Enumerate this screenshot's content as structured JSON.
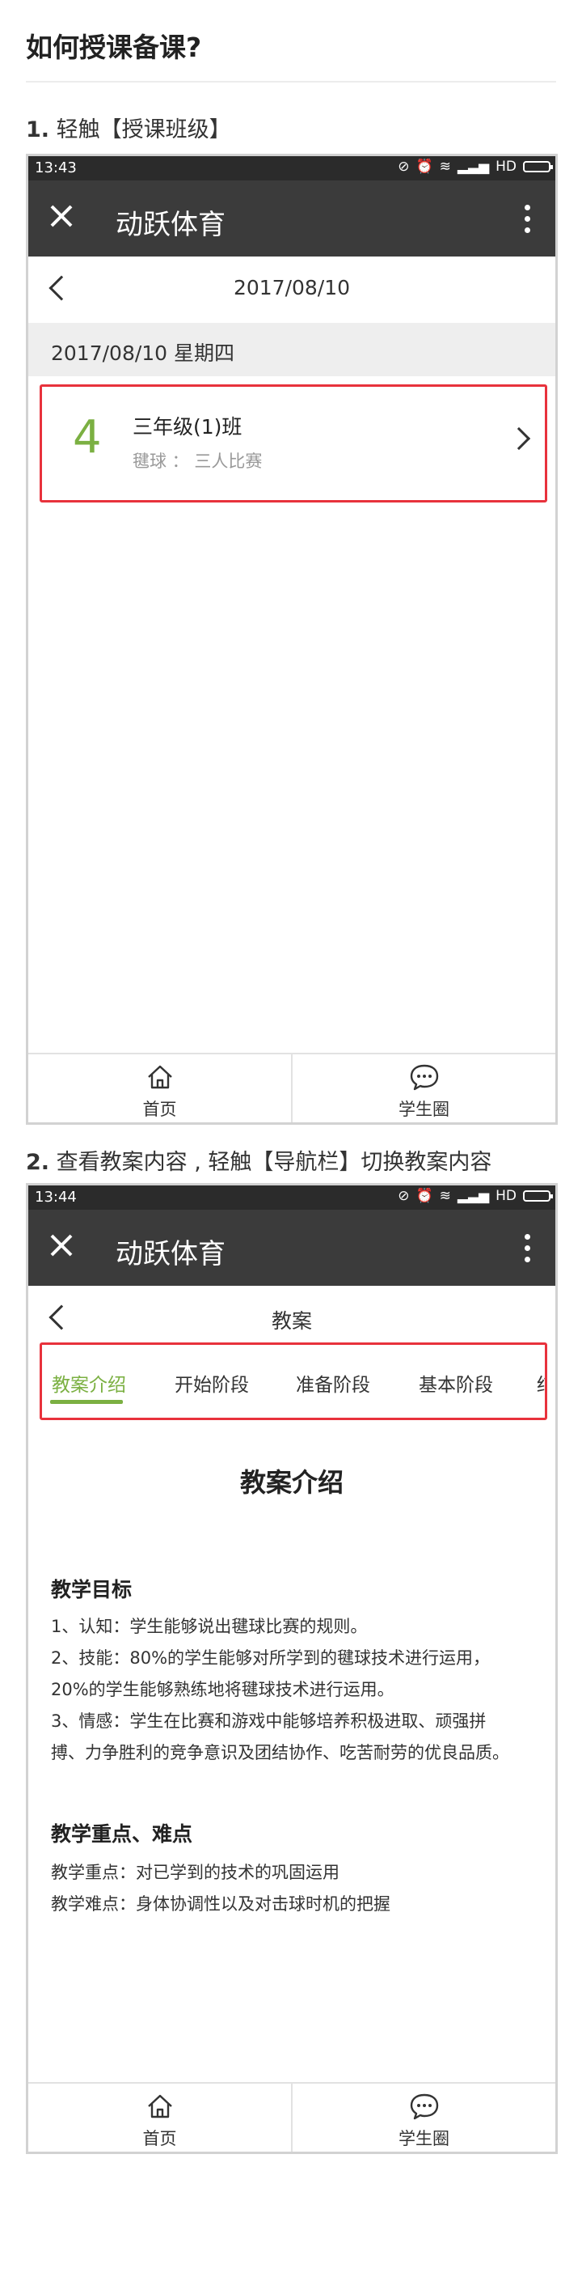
{
  "page": {
    "title": "如何授课备课?"
  },
  "step1": {
    "num": "1.",
    "text": "轻触【授课班级】",
    "status": {
      "time": "13:43",
      "network": "HD"
    },
    "appbar": {
      "title": "动跃体育"
    },
    "nav": {
      "title": "2017/08/10"
    },
    "date_header": "2017/08/10 星期四",
    "class_item": {
      "count": "4",
      "name": "三年级(1)班",
      "subtitle": "毽球 ： 三人比赛"
    },
    "tabbar": [
      {
        "label": "首页",
        "icon": "home-icon"
      },
      {
        "label": "学生圈",
        "icon": "chat-bubble-icon"
      }
    ]
  },
  "step2": {
    "num": "2.",
    "text": "查看教案内容 , 轻触【导航栏】切换教案内容",
    "status": {
      "time": "13:44",
      "network": "HD"
    },
    "appbar": {
      "title": "动跃体育"
    },
    "nav": {
      "title": "教案"
    },
    "tabs": [
      "教案介绍",
      "开始阶段",
      "准备阶段",
      "基本阶段",
      "结束"
    ],
    "active_tab": "教案介绍",
    "doc": {
      "heading": "教案介绍",
      "section1_title": "教学目标",
      "section1_lines": [
        "1、认知：学生能够说出毽球比赛的规则。",
        "2、技能：80%的学生能够对所学到的毽球技术进行运用，",
        "20%的学生能够熟练地将毽球技术进行运用。",
        "3、情感：学生在比赛和游戏中能够培养积极进取、顽强拼",
        "搏、力争胜利的竞争意识及团结协作、吃苦耐劳的优良品质。"
      ],
      "section2_title": "教学重点、难点",
      "section2_lines": [
        "教学重点：对已学到的技术的巩固运用",
        "教学难点：身体协调性以及对击球时机的把握"
      ]
    },
    "tabbar": [
      {
        "label": "首页",
        "icon": "home-icon"
      },
      {
        "label": "学生圈",
        "icon": "chat-bubble-icon"
      }
    ]
  },
  "colors": {
    "accent_green": "#7bb042",
    "highlight_red": "#e8323c",
    "appbar_dark": "#3b3b3b",
    "statusbar_dark": "#2b2b2b"
  }
}
